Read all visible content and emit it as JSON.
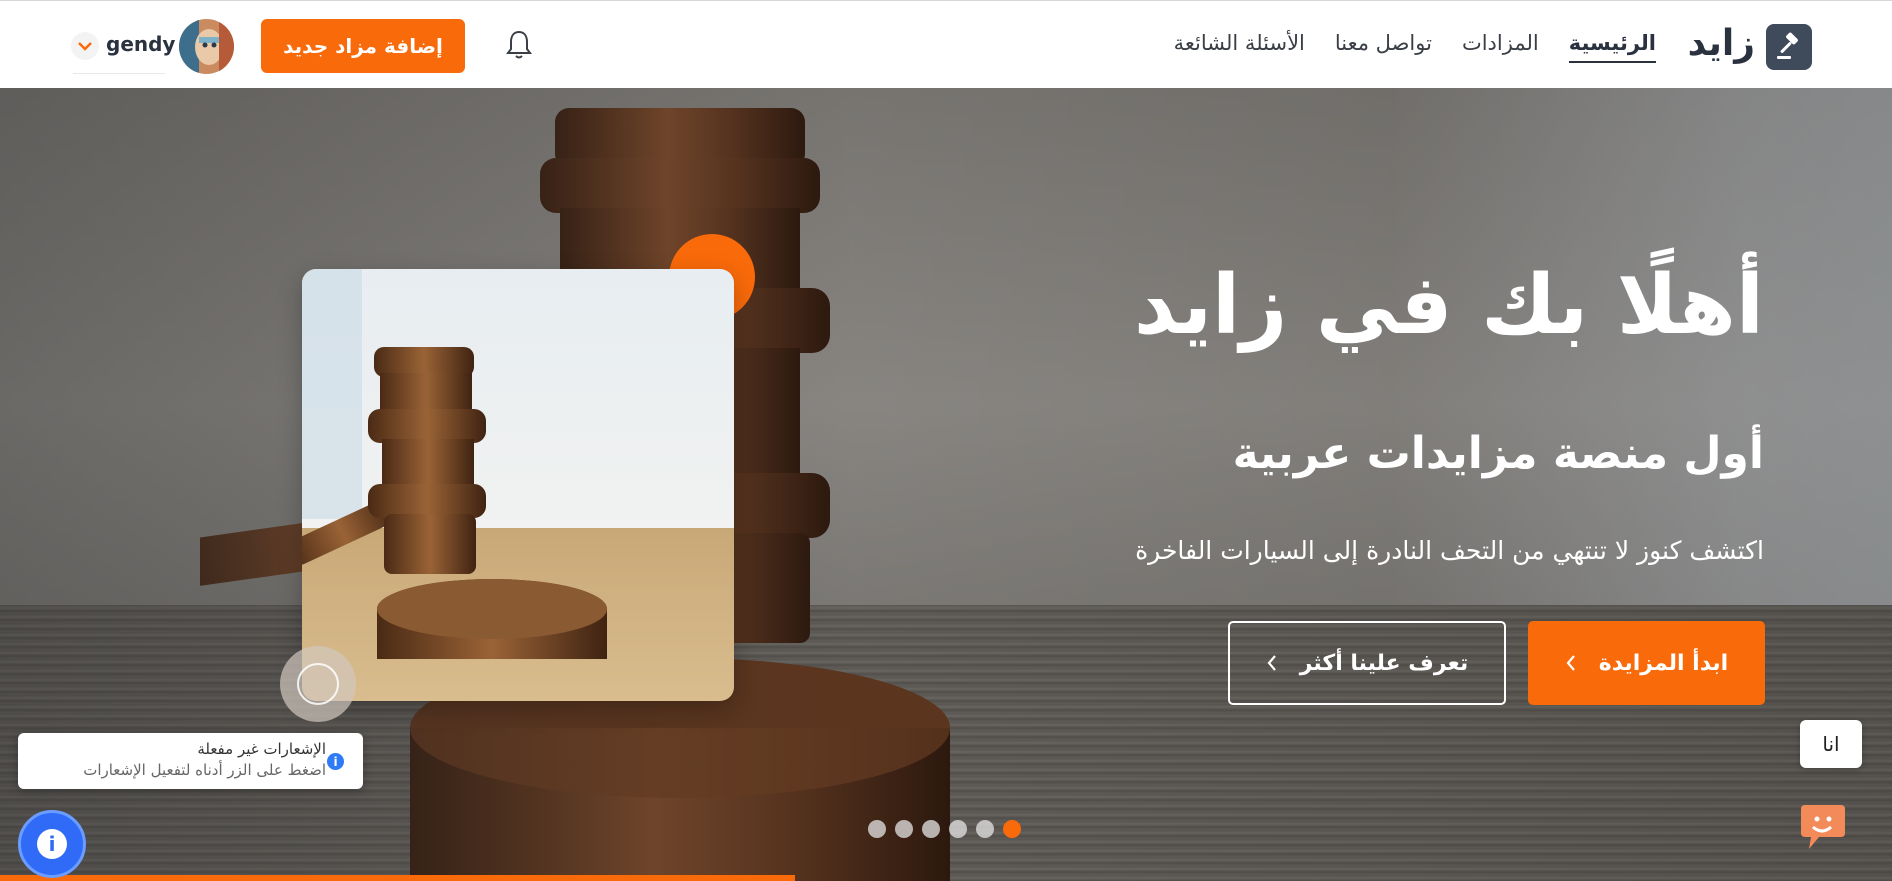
{
  "brand": {
    "name": "زايد"
  },
  "nav": {
    "items": [
      {
        "label": "الرئيسية",
        "active": true
      },
      {
        "label": "المزادات",
        "active": false
      },
      {
        "label": "تواصل معنا",
        "active": false
      },
      {
        "label": "الأسئلة الشائعة",
        "active": false
      }
    ]
  },
  "header": {
    "add_auction_label": "إضافة مزاد جديد",
    "username": "gendy"
  },
  "hero": {
    "title": "أهلًا بك في زايد",
    "subtitle": "أول منصة مزايدات عربية",
    "description": "اكتشف كنوز لا تنتهي من التحف النادرة إلى السيارات الفاخرة",
    "start_bidding_label": "ابدأ المزايدة",
    "about_us_label": "تعرف علينا أكثر",
    "slides_total": 6,
    "active_slide": 6
  },
  "notification": {
    "title": "الإشعارات غير مفعلة",
    "subtitle": "اضغط على الزر أدناه لتفعيل الإشعارات"
  },
  "chat": {
    "bubble_text": "انا"
  },
  "colors": {
    "accent": "#f96a0a",
    "dark": "#2a3240",
    "info": "#2f6bf6"
  },
  "icons": {
    "logo": "gavel-icon",
    "bell": "bell-icon",
    "chevron": "chevron-down-icon",
    "button_arrow": "chevron-left-icon",
    "info": "info-icon",
    "chat": "chat-icon"
  }
}
